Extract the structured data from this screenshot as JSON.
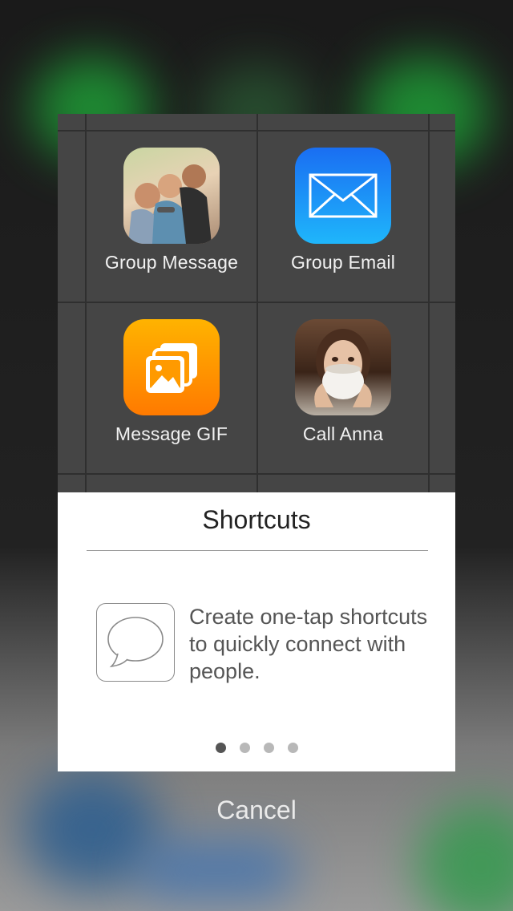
{
  "tiles": [
    {
      "label": "Group Message",
      "icon": "group-photo"
    },
    {
      "label": "Group Email",
      "icon": "mail-envelope"
    },
    {
      "label": "Message GIF",
      "icon": "photo-stack"
    },
    {
      "label": "Call Anna",
      "icon": "contact-photo"
    }
  ],
  "panel": {
    "title": "Shortcuts",
    "description": "Create one-tap shortcuts to quickly connect with people.",
    "page_dots": {
      "count": 4,
      "active": 1
    }
  },
  "cancel_label": "Cancel",
  "colors": {
    "grid_background": "#454545",
    "mail_gradient": [
      "#1a6ef2",
      "#1fb6fb"
    ],
    "gif_gradient": [
      "#ffb300",
      "#ff7a00"
    ],
    "dot_active": "#555555",
    "dot_inactive": "#b8b8b8"
  }
}
